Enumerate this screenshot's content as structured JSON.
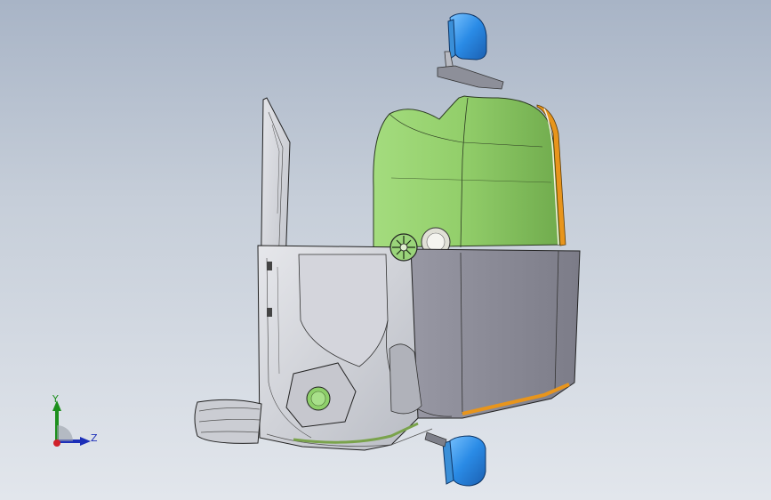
{
  "viewport": {
    "background_top": "#a8b4c6",
    "background_bottom": "#e2e6ec"
  },
  "model": {
    "body_color": "#8ac96a",
    "housing_color": "#8a8a96",
    "accent_color": "#e8951c",
    "mirror_color": "#2f8fe6",
    "tire_color": "#c9ccd2",
    "frame_color": "#d2d4da"
  },
  "triad": {
    "y_label": "Y",
    "z_label": "Z",
    "y_color": "#1c8f1c",
    "z_color": "#1c2fb8",
    "x_color": "#d0202a"
  }
}
